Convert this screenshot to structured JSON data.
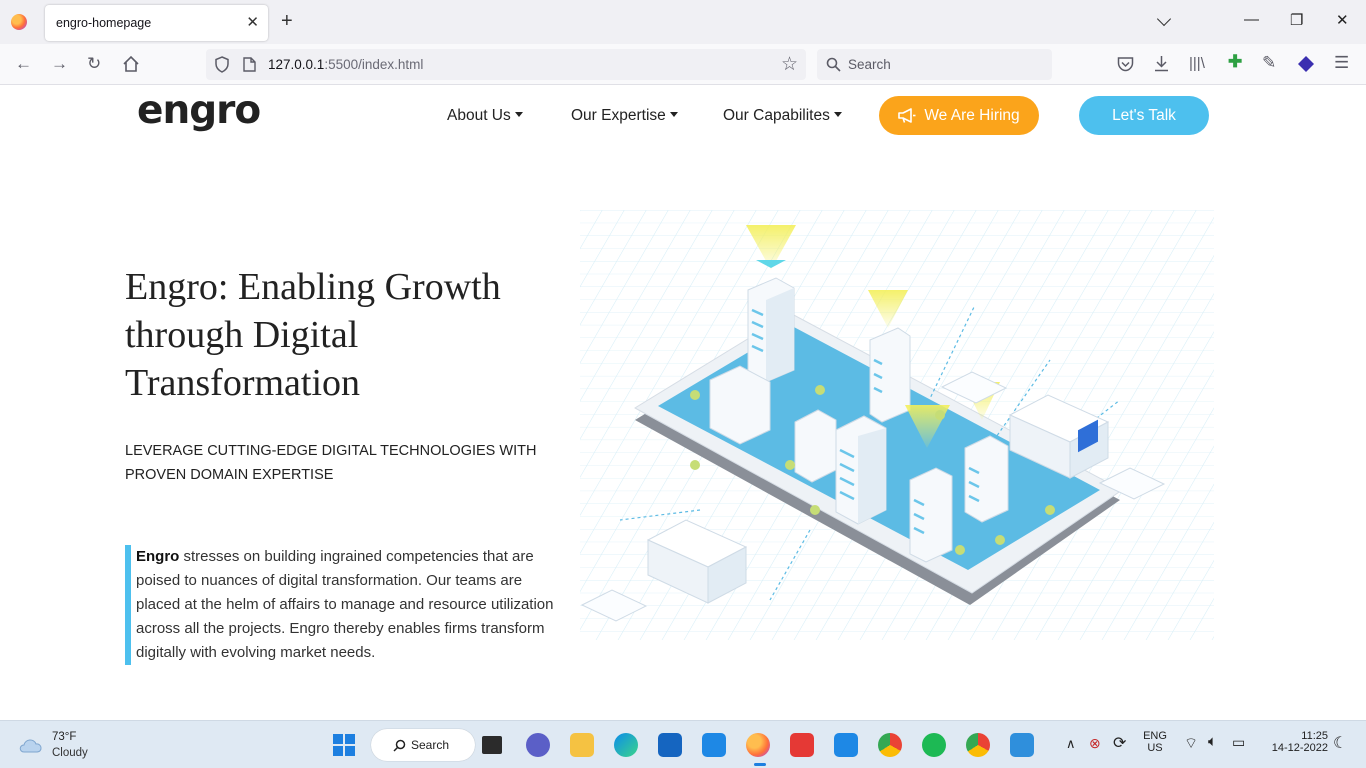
{
  "browser": {
    "tab_title": "engro-homepage",
    "url_host": "127.0.0.1",
    "url_rest": ":5500/index.html",
    "search_placeholder": "Search"
  },
  "site": {
    "logo_text": "engro",
    "nav": {
      "about": "About Us",
      "expertise": "Our Expertise",
      "capabilities": "Our Capabilites",
      "hiring": "We Are Hiring",
      "talk": "Let's Talk"
    },
    "hero": {
      "title": "Engro: Enabling Growth through Digital Transformation",
      "subtitle": "LEVERAGE CUTTING-EDGE DIGITAL TECHNOLOGIES WITH PROVEN DOMAIN EXPERTISE",
      "body_bold": "Engro",
      "body_rest": " stresses on building ingrained competencies that are poised to nuances of digital transformation. Our teams are placed at the helm of affairs to manage and resource utilization across all the projects. Engro thereby enables firms transform digitally with evolving market needs."
    },
    "colors": {
      "accent_blue": "#4dc0ee",
      "accent_orange": "#fba41b"
    }
  },
  "taskbar": {
    "weather_temp": "73°F",
    "weather_cond": "Cloudy",
    "search_label": "Search",
    "lang_top": "ENG",
    "lang_bottom": "US",
    "time": "11:25",
    "date": "14-12-2022"
  }
}
